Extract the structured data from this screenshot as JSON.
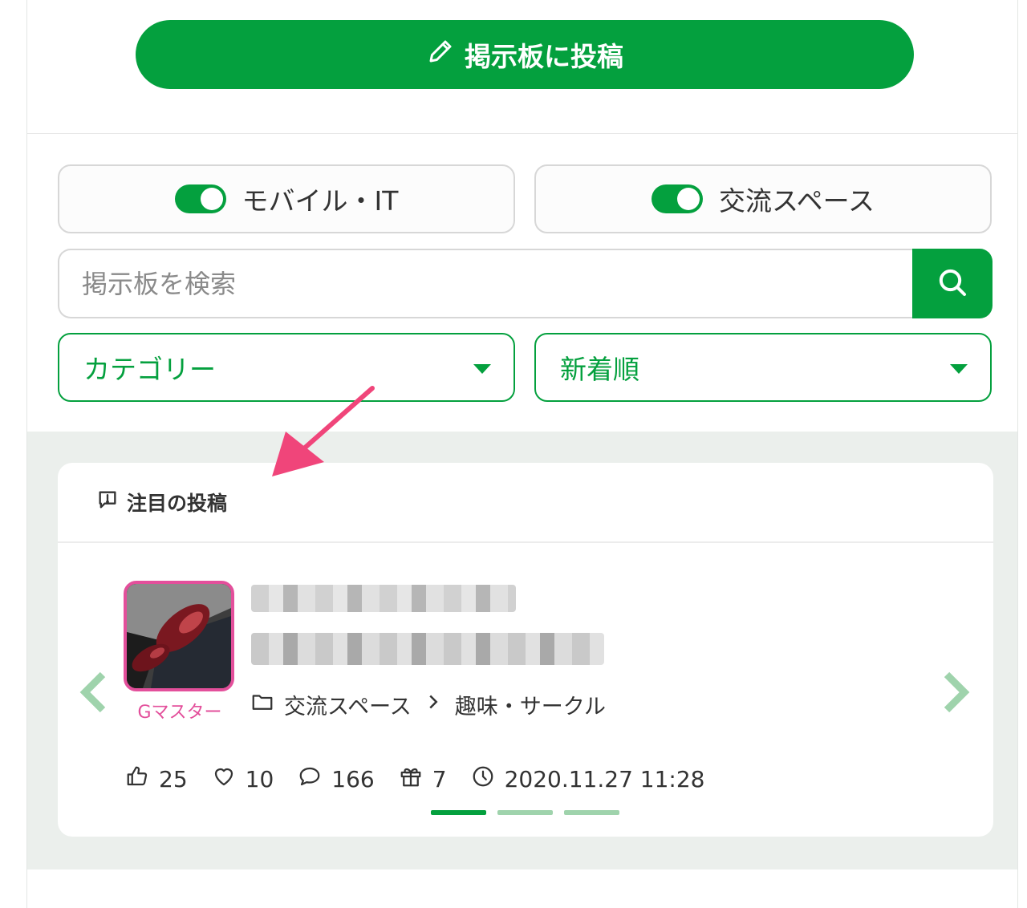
{
  "post_button": {
    "label": "掲示板に投稿",
    "icon": "pencil-icon"
  },
  "toggles": [
    {
      "label": "モバイル・IT",
      "on": true
    },
    {
      "label": "交流スペース",
      "on": true
    }
  ],
  "search": {
    "placeholder": "掲示板を検索",
    "icon": "search-icon"
  },
  "selects": {
    "category": "カテゴリー",
    "sort": "新着順"
  },
  "featured": {
    "heading": "注目の投稿",
    "post": {
      "author": "Gマスター",
      "breadcrumb": {
        "parent": "交流スペース",
        "child": "趣味・サークル"
      },
      "stats": {
        "likes": "25",
        "favorites": "10",
        "comments": "166",
        "gifts": "7",
        "datetime": "2020.11.27 11:28"
      }
    },
    "pages": 3,
    "active_page": 1
  },
  "colors": {
    "accent": "#04a03e",
    "author": "#e34f9b",
    "section_bg": "#ebefec",
    "annotation": "#f0457a"
  }
}
